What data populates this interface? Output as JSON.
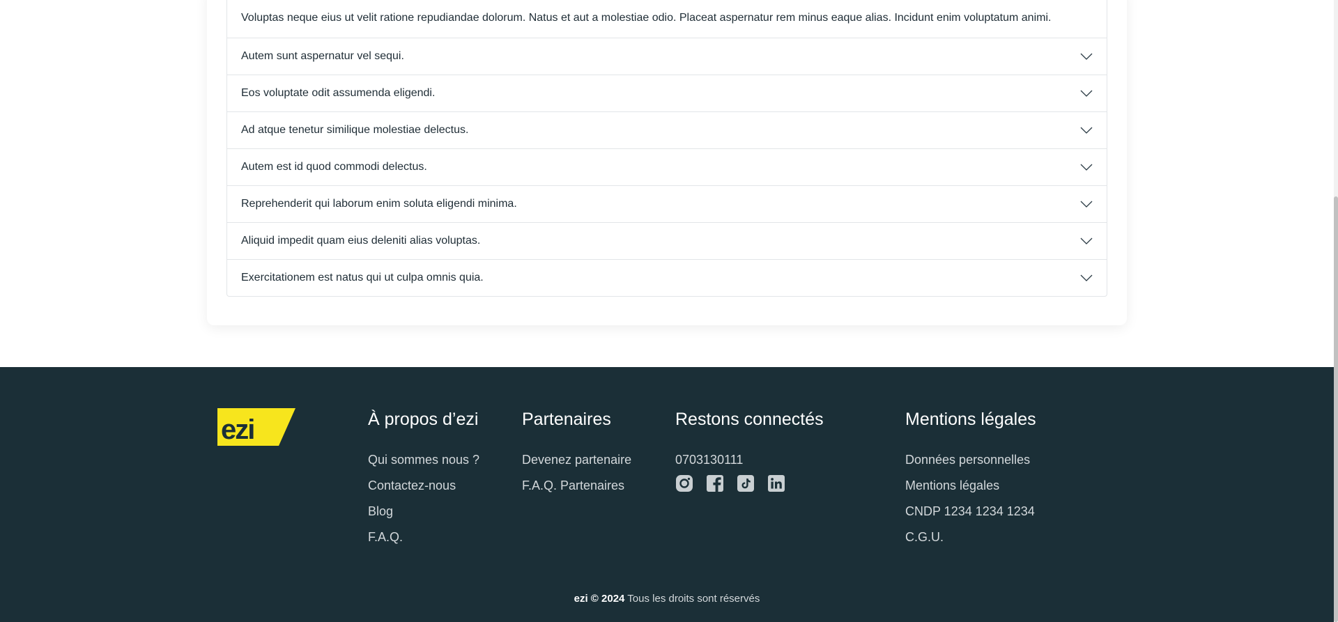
{
  "faq": {
    "open_answer": "Voluptas neque eius ut velit ratione repudiandae dolorum. Natus et aut a molestiae odio. Placeat aspernatur rem minus eaque alias. Incidunt enim voluptatum animi.",
    "items": [
      {
        "question": "Autem sunt aspernatur vel sequi."
      },
      {
        "question": "Eos voluptate odit assumenda eligendi."
      },
      {
        "question": "Ad atque tenetur similique molestiae delectus."
      },
      {
        "question": "Autem est id quod commodi delectus."
      },
      {
        "question": "Reprehenderit qui laborum enim soluta eligendi minima."
      },
      {
        "question": "Aliquid impedit quam eius deleniti alias voluptas."
      },
      {
        "question": "Exercitationem est natus qui ut culpa omnis quia."
      }
    ]
  },
  "footer": {
    "logo_text": "ezi",
    "about": {
      "title": "À propos d’ezi",
      "links": [
        "Qui sommes nous ?",
        "Contactez-nous",
        "Blog",
        "F.A.Q."
      ]
    },
    "partners": {
      "title": "Partenaires",
      "links": [
        "Devenez partenaire",
        "F.A.Q. Partenaires"
      ]
    },
    "connect": {
      "title": "Restons connectés",
      "phone": "0703130111",
      "social_icons": [
        "instagram-icon",
        "facebook-icon",
        "tiktok-icon",
        "linkedin-icon"
      ]
    },
    "legal": {
      "title": "Mentions légales",
      "links": [
        "Données personnelles",
        "Mentions légales",
        "CNDP 1234 1234 1234",
        "C.G.U."
      ]
    },
    "copyright_brand": "ezi © 2024",
    "copyright_text": " Tous les droits sont réservés"
  },
  "colors": {
    "footer_bg": "#1b2f37",
    "brand_yellow": "#f7e51d",
    "logo_text": "#1b2f37"
  }
}
